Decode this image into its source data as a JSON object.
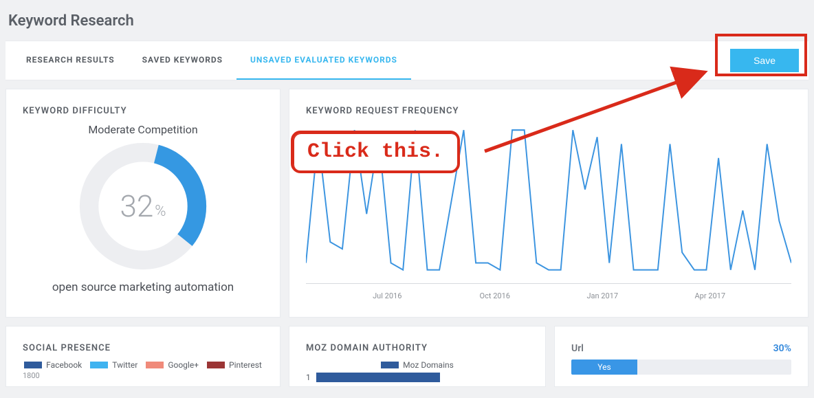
{
  "page_title": "Keyword Research",
  "tabs": {
    "research_results": "RESEARCH RESULTS",
    "saved_keywords": "SAVED KEYWORDS",
    "unsaved_evaluated": "UNSAVED EVALUATED KEYWORDS"
  },
  "save_button": "Save",
  "difficulty": {
    "title": "KEYWORD DIFFICULTY",
    "subtitle": "Moderate Competition",
    "percent": 32,
    "percent_symbol": "%",
    "keyword": "open source marketing automation"
  },
  "frequency": {
    "title": "KEYWORD REQUEST FREQUENCY",
    "ticks": [
      "Jul 2016",
      "Oct 2016",
      "Jan 2017",
      "Apr 2017"
    ]
  },
  "social": {
    "title": "SOCIAL PRESENCE",
    "legend": {
      "facebook": "Facebook",
      "twitter": "Twitter",
      "google": "Google+",
      "pinterest": "Pinterest"
    },
    "y_max": "1800"
  },
  "moz": {
    "title": "MOZ DOMAIN AUTHORITY",
    "legend_label": "Moz Domains",
    "bar_label": "1"
  },
  "url_card": {
    "label": "Url",
    "pct": "30%",
    "yes": "Yes"
  },
  "annotation": {
    "text": "Click this."
  },
  "chart_data": [
    {
      "type": "line",
      "title": "Keyword Request Frequency",
      "x_ticks": [
        "Jul 2016",
        "Oct 2016",
        "Jan 2017",
        "Apr 2017"
      ],
      "series": [
        {
          "name": "frequency",
          "values_relative": [
            10,
            95,
            25,
            20,
            100,
            40,
            95,
            10,
            5,
            100,
            5,
            5,
            55,
            100,
            10,
            10,
            5,
            100,
            100,
            10,
            5,
            5,
            100,
            60,
            95,
            10,
            90,
            5,
            5,
            5,
            90,
            15,
            5,
            5,
            80,
            5,
            45,
            5,
            90,
            40
          ]
        }
      ],
      "xlabel": "",
      "ylabel": "",
      "note": "Values are relative heights (0-100) estimated from unlabeled y-axis."
    },
    {
      "type": "bar",
      "title": "Moz Domain Authority",
      "categories": [
        "1"
      ],
      "series": [
        {
          "name": "Moz Domains",
          "values": [
            null
          ]
        }
      ],
      "note": "Only one bar row visible with label '1'; magnitude axis not shown."
    },
    {
      "type": "bar",
      "title": "Url",
      "categories": [
        "Yes"
      ],
      "values": [
        30
      ],
      "ylim": [
        0,
        100
      ],
      "unit": "percent"
    },
    {
      "type": "bar",
      "title": "Social Presence",
      "categories": [],
      "series": [
        {
          "name": "Facebook",
          "values": []
        },
        {
          "name": "Twitter",
          "values": []
        },
        {
          "name": "Google+",
          "values": []
        },
        {
          "name": "Pinterest",
          "values": []
        }
      ],
      "ylim": [
        0,
        1800
      ],
      "note": "Only legend and y-axis tick 1800 visible; data area cropped."
    }
  ]
}
